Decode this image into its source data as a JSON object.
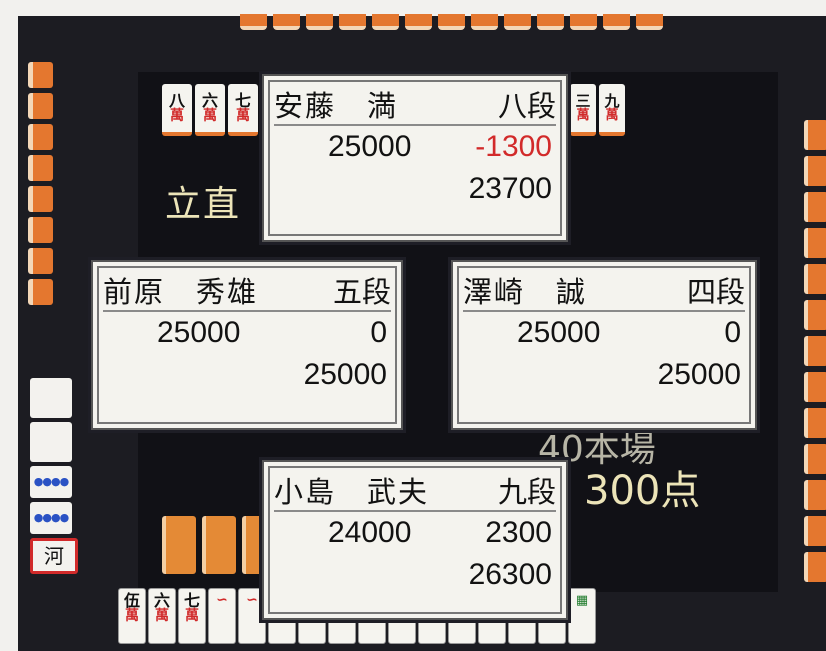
{
  "colors": {
    "board": "#1c1c22",
    "felt": "#111116",
    "tile_edge": "#e4772f",
    "score_loss": "#d22a2a",
    "panel_bg": "#f4f3ee"
  },
  "table": {
    "riichi_label": "立直",
    "honba_label": "40本場",
    "points_label": "300点"
  },
  "discards": {
    "top": [
      {
        "num": "八",
        "suit": "萬"
      },
      {
        "num": "六",
        "suit": "萬"
      },
      {
        "num": "七",
        "suit": "萬"
      }
    ],
    "right": [
      {
        "num": "三",
        "suit": "萬"
      },
      {
        "num": "九",
        "suit": "萬"
      }
    ]
  },
  "hand": {
    "tiles": [
      {
        "num": "伍",
        "suit": "萬"
      },
      {
        "num": "六",
        "suit": "萬"
      },
      {
        "num": "七",
        "suit": "萬"
      }
    ]
  },
  "left_stack": {
    "river_tile": "河"
  },
  "players": {
    "top": {
      "name": "安藤　満",
      "rank": "八段",
      "base": "25000",
      "delta": "-1300",
      "total": "23700"
    },
    "left": {
      "name": "前原　秀雄",
      "rank": "五段",
      "base": "25000",
      "delta": "0",
      "total": "25000"
    },
    "right": {
      "name": "澤崎　誠",
      "rank": "四段",
      "base": "25000",
      "delta": "0",
      "total": "25000"
    },
    "bottom": {
      "name": "小島　武夫",
      "rank": "九段",
      "base": "24000",
      "delta": "2300",
      "total": "26300"
    }
  }
}
